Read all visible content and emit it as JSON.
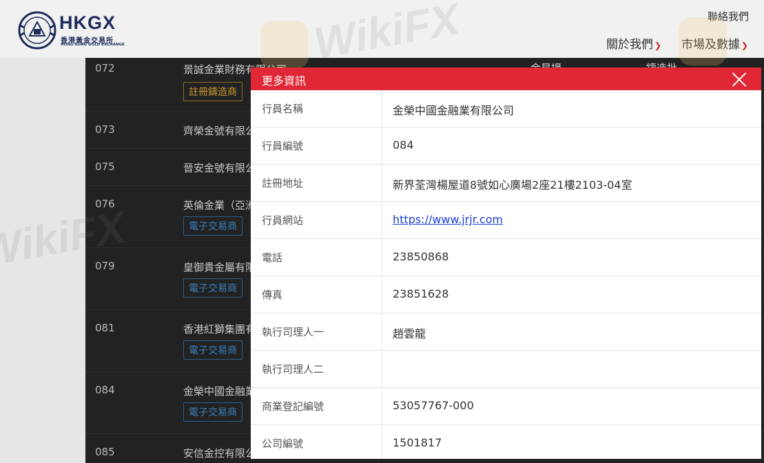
{
  "header": {
    "logo_word": "HKGX",
    "logo_cn": "香港黃金交易所",
    "logo_en": "HONG KONG GOLD EXCHANGE",
    "contact": "聯絡我們",
    "nav": [
      {
        "label": "關於我們"
      },
      {
        "label": "市場及數據"
      }
    ]
  },
  "watermark": "WikiFX",
  "members": [
    {
      "id": "072",
      "name": "景誠金業財務有限公司",
      "tag": "註冊鑄造商",
      "tag_type": "gold",
      "extra": [
        "金星場",
        "鑄造批"
      ]
    },
    {
      "id": "073",
      "name": "齊榮金號有限公"
    },
    {
      "id": "075",
      "name": "晉安金號有限公"
    },
    {
      "id": "076",
      "name": "英倫金業（亞洲",
      "tag": "電子交易商",
      "tag_type": "blue"
    },
    {
      "id": "079",
      "name": "皇御貴金屬有限",
      "tag": "電子交易商",
      "tag_type": "blue"
    },
    {
      "id": "081",
      "name": "香港紅獅集團有",
      "tag": "電子交易商",
      "tag_type": "blue"
    },
    {
      "id": "084",
      "name": "金榮中國金融業",
      "tag": "電子交易商",
      "tag_type": "blue"
    },
    {
      "id": "085",
      "name": "安信金控有限公"
    }
  ],
  "modal": {
    "title": "更多資訊",
    "rows": [
      {
        "label": "行員名稱",
        "value": "金榮中國金融業有限公司"
      },
      {
        "label": "行員編號",
        "value": "084"
      },
      {
        "label": "註冊地址",
        "value": "新界荃灣楊屋道8號如心廣場2座21樓2103-04室"
      },
      {
        "label": "行員網站",
        "value": "https://www.jrjr.com",
        "link": true
      },
      {
        "label": "電話",
        "value": "23850868"
      },
      {
        "label": "傳真",
        "value": "23851628"
      },
      {
        "label": "執行司理人一",
        "value": "趙雲龍"
      },
      {
        "label": "執行司理人二",
        "value": ""
      },
      {
        "label": "商業登記編號",
        "value": "53057767-000"
      },
      {
        "label": "公司編號",
        "value": "1501817"
      }
    ]
  }
}
